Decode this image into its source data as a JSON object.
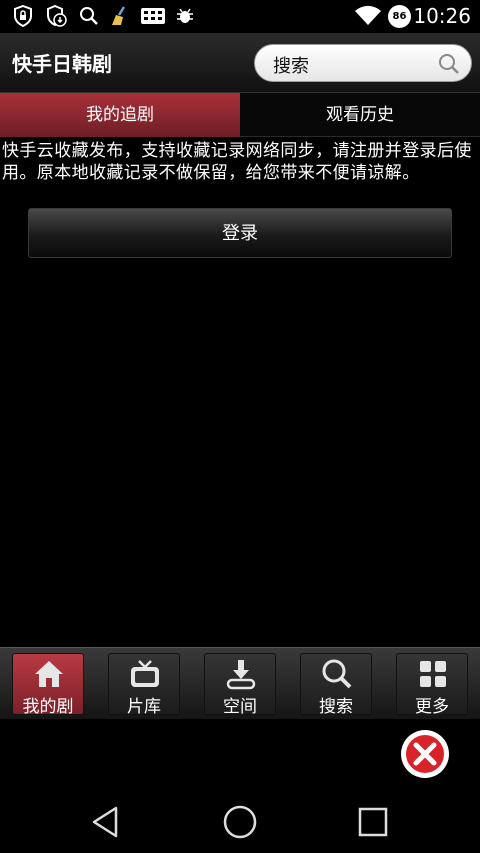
{
  "status_bar": {
    "time": "10:26",
    "battery_level": "86",
    "icons": [
      "shield-lock-icon",
      "shield-download-icon",
      "search-icon",
      "broom-icon",
      "keyboard-icon",
      "bug-icon",
      "wifi-icon",
      "battery-icon"
    ]
  },
  "header": {
    "title": "快手日韩剧",
    "search_label": "搜索"
  },
  "tabs": [
    {
      "label": "我的追剧",
      "active": true
    },
    {
      "label": "观看历史",
      "active": false
    }
  ],
  "notice": {
    "text": "快手云收藏发布，支持收藏记录网络同步，请注册并登录后使用。原本地收藏记录不做保留，给您带来不便请谅解。"
  },
  "login_button": {
    "label": "登录"
  },
  "bottom_nav": [
    {
      "label": "我的剧",
      "icon": "home-icon",
      "active": true
    },
    {
      "label": "片库",
      "icon": "tv-icon",
      "active": false
    },
    {
      "label": "空间",
      "icon": "download-icon",
      "active": false
    },
    {
      "label": "搜索",
      "icon": "search-icon",
      "active": false
    },
    {
      "label": "更多",
      "icon": "grid-icon",
      "active": false
    }
  ],
  "colors": {
    "accent": "#9a2a33",
    "close_button": "#d8232a"
  }
}
